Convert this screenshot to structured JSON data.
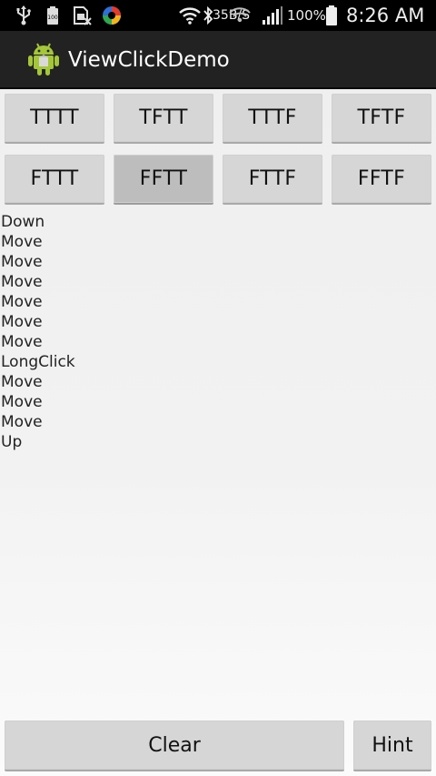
{
  "status_bar": {
    "speed": "35B/S",
    "battery_percent": "100%",
    "time": "8:26 AM",
    "notification_icons": [
      "usb-icon",
      "battery-saver-icon",
      "sim-blocked-icon",
      "app-notification-icon"
    ],
    "system_icons": [
      "wifi-icon",
      "bluetooth-icon",
      "hotspot-icon",
      "signal-icon",
      "battery-icon"
    ]
  },
  "action_bar": {
    "title": "ViewClickDemo",
    "icon": "android-icon",
    "background": "#222222"
  },
  "grid_buttons": [
    {
      "label": "TTTT",
      "pressed": false
    },
    {
      "label": "TFTT",
      "pressed": false
    },
    {
      "label": "TTTF",
      "pressed": false
    },
    {
      "label": "TFTF",
      "pressed": false
    },
    {
      "label": "FTTT",
      "pressed": false
    },
    {
      "label": "FFTT",
      "pressed": true
    },
    {
      "label": "FTTF",
      "pressed": false
    },
    {
      "label": "FFTF",
      "pressed": false
    }
  ],
  "event_log": [
    "Down",
    "Move",
    "Move",
    "Move",
    "Move",
    "Move",
    "Move",
    "LongClick",
    "Move",
    "Move",
    "Move",
    "Up"
  ],
  "bottom_buttons": {
    "clear_label": "Clear",
    "hint_label": "Hint"
  },
  "colors": {
    "button_bg": "#d6d6d6",
    "button_pressed_bg": "#bdbdbd",
    "android_green": "#a4c639"
  }
}
